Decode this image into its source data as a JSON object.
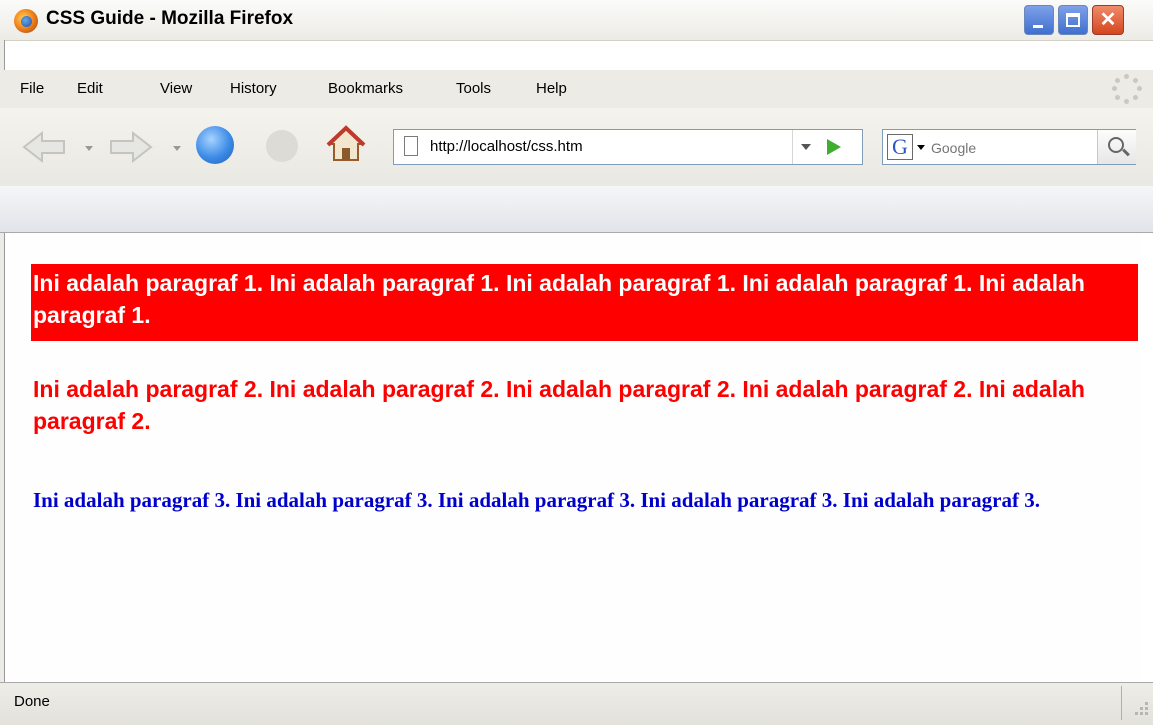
{
  "window": {
    "title": "CSS Guide - Mozilla Firefox"
  },
  "menu": {
    "items": [
      "File",
      "Edit",
      "View",
      "History",
      "Bookmarks",
      "Tools",
      "Help"
    ]
  },
  "navigation": {
    "url": "http://localhost/css.htm",
    "search_placeholder": "Google",
    "search_engine_letter": "G"
  },
  "content": {
    "paragraph1": "Ini adalah paragraf 1. Ini adalah paragraf 1. Ini adalah paragraf 1. Ini adalah paragraf 1. Ini adalah paragraf 1.",
    "paragraph2": "Ini adalah paragraf 2. Ini adalah paragraf 2. Ini adalah paragraf 2. Ini adalah paragraf 2. Ini adalah paragraf 2.",
    "paragraph3": "Ini adalah paragraf 3. Ini adalah paragraf 3. Ini adalah paragraf 3. Ini adalah paragraf 3. Ini adalah paragraf 3."
  },
  "status": {
    "text": "Done"
  },
  "colors": {
    "paragraph1_background": "#ff0000",
    "paragraph1_text": "#ffffff",
    "paragraph2_text": "#ff0000",
    "paragraph3_text": "#0000cc"
  }
}
